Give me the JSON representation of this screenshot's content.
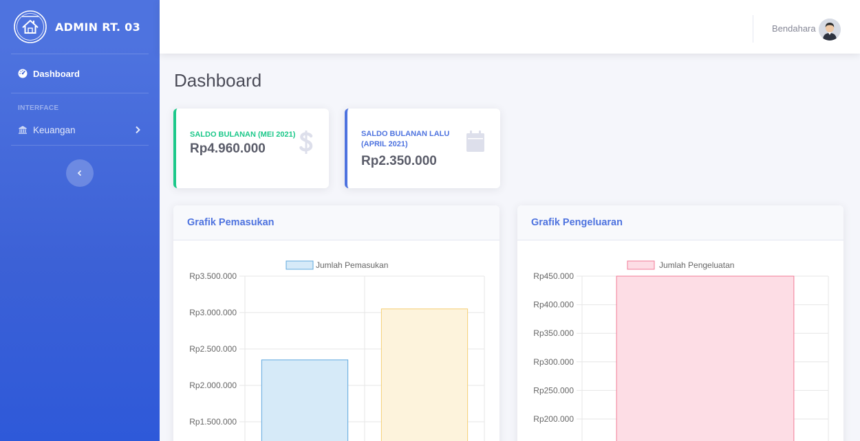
{
  "sidebar": {
    "brand": "ADMIN RT. 03",
    "logo_name": "house-logo-icon",
    "nav_dashboard": "Dashboard",
    "heading_interface": "INTERFACE",
    "nav_keuangan": "Keuangan",
    "toggle_icon": "chevron-left-icon"
  },
  "topbar": {
    "user_name": "Bendahara"
  },
  "page": {
    "title": "Dashboard"
  },
  "stats": [
    {
      "label": "SALDO BULANAN (MEI 2021)",
      "value": "Rp4.960.000",
      "icon": "dollar-icon",
      "color": "#1cc88a"
    },
    {
      "label": "SALDO BULANAN LALU (APRIL 2021)",
      "value": "Rp2.350.000",
      "icon": "calendar-icon",
      "color": "#4e73df"
    }
  ],
  "charts": {
    "pemasukan_title": "Grafik Pemasukan",
    "pengeluaran_title": "Grafik Pengeluaran"
  },
  "chart_data": [
    {
      "type": "bar",
      "title": "Grafik Pemasukan",
      "series": [
        {
          "name": "Jumlah Pemasukan",
          "values": [
            2350000,
            3050000
          ]
        }
      ],
      "bar_colors": [
        {
          "fill": "#d6eaf8",
          "stroke": "#5fa8de"
        },
        {
          "fill": "#fdf3dc",
          "stroke": "#f5cf74"
        }
      ],
      "yticks": [
        "Rp3.500.000",
        "Rp3.000.000",
        "Rp2.500.000",
        "Rp2.000.000",
        "Rp1.500.000"
      ],
      "ytick_values": [
        3500000,
        3000000,
        2500000,
        2000000,
        1500000
      ],
      "ylim": [
        1500000,
        3500000
      ],
      "grid": true,
      "legend": "top"
    },
    {
      "type": "bar",
      "title": "Grafik Pengeluaran",
      "series": [
        {
          "name": "Jumlah Pengeluatan",
          "values": [
            450000
          ]
        }
      ],
      "bar_colors": [
        {
          "fill": "#fddde5",
          "stroke": "#f27a96"
        }
      ],
      "yticks": [
        "Rp450.000",
        "Rp400.000",
        "Rp350.000",
        "Rp300.000",
        "Rp250.000",
        "Rp200.000"
      ],
      "ytick_values": [
        450000,
        400000,
        350000,
        300000,
        250000,
        200000
      ],
      "ylim": [
        200000,
        450000
      ],
      "grid": true,
      "legend": "top"
    }
  ]
}
